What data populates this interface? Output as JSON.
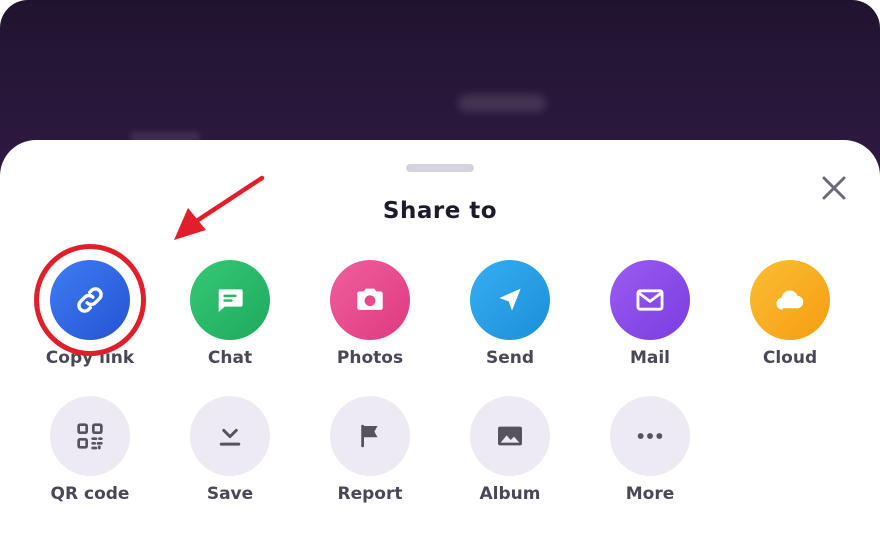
{
  "sheet": {
    "title": "Share to",
    "close_icon": "close-icon"
  },
  "row1": [
    {
      "label": "Copy link",
      "icon": "link-icon",
      "color": "#2f66e4"
    },
    {
      "label": "Chat",
      "icon": "chat-icon",
      "color": "#27b866"
    },
    {
      "label": "Photos",
      "icon": "camera-icon",
      "color": "#e64a8b"
    },
    {
      "label": "Send",
      "icon": "send-icon",
      "color": "#29a0e6"
    },
    {
      "label": "Mail",
      "icon": "mail-icon",
      "color": "#8a4ae8"
    },
    {
      "label": "Cloud",
      "icon": "cloud-icon",
      "color": "#f8ad1f"
    }
  ],
  "row2": [
    {
      "label": "QR code",
      "icon": "qr-code-icon"
    },
    {
      "label": "Save",
      "icon": "download-icon"
    },
    {
      "label": "Report",
      "icon": "flag-icon"
    },
    {
      "label": "Album",
      "icon": "image-icon"
    },
    {
      "label": "More",
      "icon": "more-dots-icon"
    }
  ],
  "annotation": {
    "highlight_color": "#e01f2b",
    "highlighted_item": "Copy link"
  }
}
